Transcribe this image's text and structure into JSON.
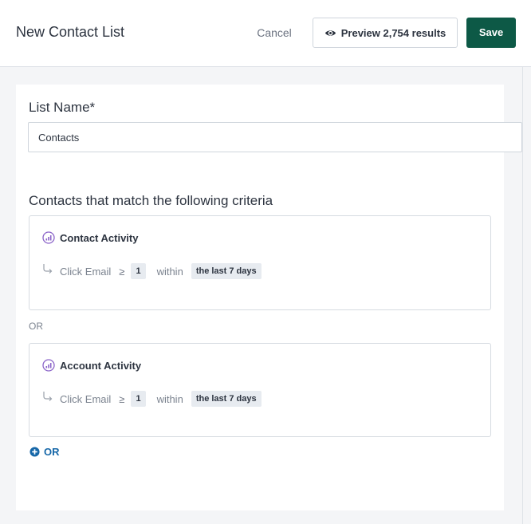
{
  "header": {
    "title": "New Contact List",
    "cancel_label": "Cancel",
    "preview_label": "Preview 2,754 results",
    "save_label": "Save"
  },
  "form": {
    "list_name_label": "List Name*",
    "list_name_value": "Contacts",
    "criteria_heading": "Contacts that match the following criteria"
  },
  "criteria": [
    {
      "title": "Contact Activity",
      "action": "Click Email",
      "operator": "≥",
      "count": "1",
      "within_label": "within",
      "period": "the last 7 days"
    },
    {
      "title": "Account Activity",
      "action": "Click Email",
      "operator": "≥",
      "count": "1",
      "within_label": "within",
      "period": "the last 7 days"
    }
  ],
  "separator_label": "OR",
  "add_or_label": "OR",
  "icons": {
    "preview": "eye-icon",
    "criteria": "activity-chart-icon",
    "condition": "return-arrow-icon",
    "add": "plus-circle-icon"
  },
  "colors": {
    "save_button": "#0d5946",
    "link": "#1667a8",
    "criteria_icon": "#8a63c8"
  }
}
